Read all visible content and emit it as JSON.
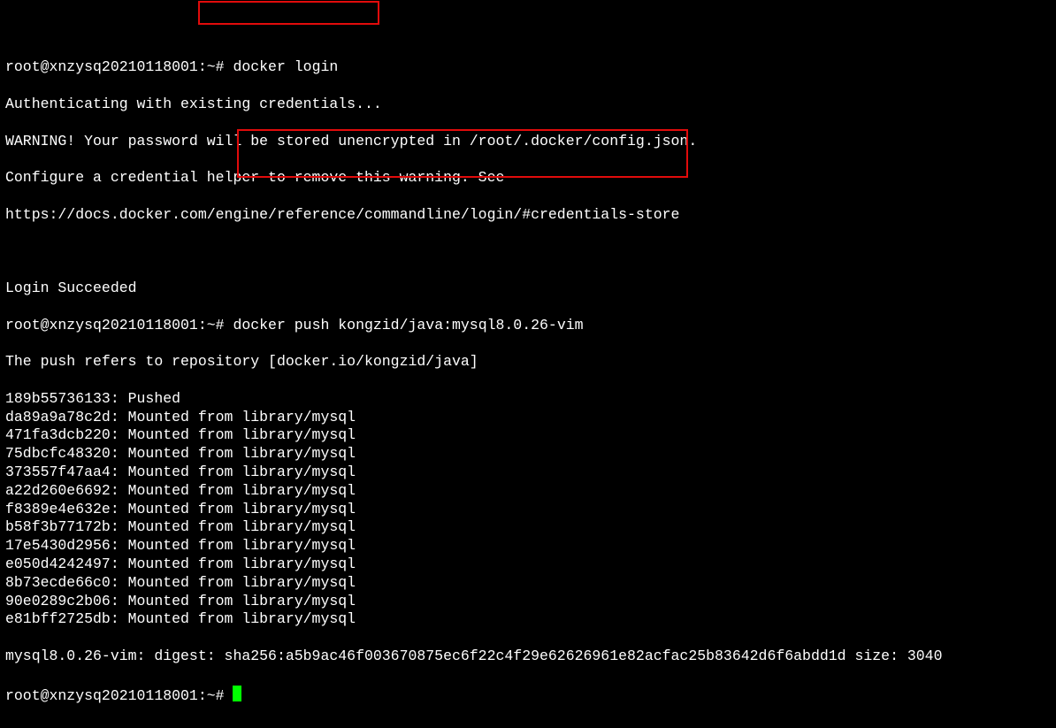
{
  "prompt1": "root@xnzysq20210118001:~# ",
  "cmd1": "docker login",
  "auth_line": "Authenticating with existing credentials...",
  "warn1": "WARNING! Your password will be stored unencrypted in /root/.docker/config.json.",
  "warn2": "Configure a credential helper to remove this warning. See",
  "warn3": "https://docs.docker.com/engine/reference/commandline/login/#credentials-store",
  "login_ok": "Login Succeeded",
  "prompt2": "root@xnzysq20210118001:~# ",
  "cmd2": "docker push kongzid/java:mysql8.0.26-vim",
  "push_repo": "The push refers to repository [docker.io/kongzid/java]",
  "layers": [
    "189b55736133: Pushed",
    "da89a9a78c2d: Mounted from library/mysql",
    "471fa3dcb220: Mounted from library/mysql",
    "75dbcfc48320: Mounted from library/mysql",
    "373557f47aa4: Mounted from library/mysql",
    "a22d260e6692: Mounted from library/mysql",
    "f8389e4e632e: Mounted from library/mysql",
    "b58f3b77172b: Mounted from library/mysql",
    "17e5430d2956: Mounted from library/mysql",
    "e050d4242497: Mounted from library/mysql",
    "8b73ecde66c0: Mounted from library/mysql",
    "90e0289c2b06: Mounted from library/mysql",
    "e81bff2725db: Mounted from library/mysql"
  ],
  "digest_line": "mysql8.0.26-vim: digest: sha256:a5b9ac46f003670875ec6f22c4f29e62626961e82acfac25b83642d6f6abdd1d size: 3040",
  "prompt3": "root@xnzysq20210118001:~# "
}
